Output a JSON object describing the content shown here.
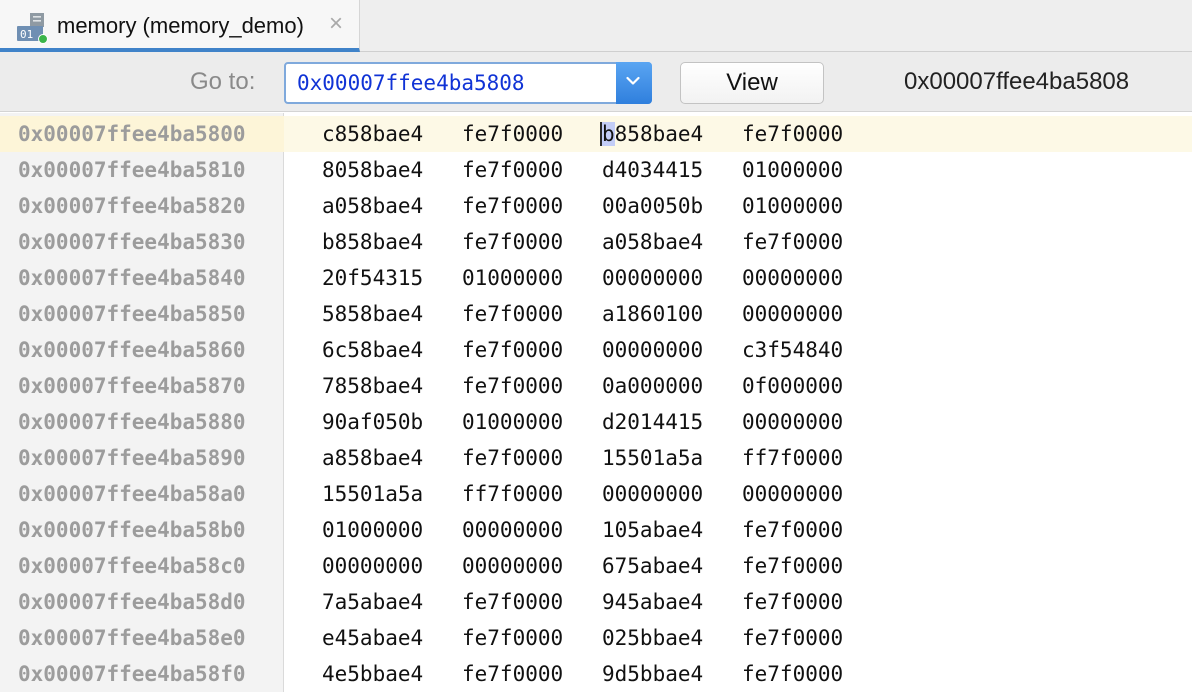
{
  "tab": {
    "title": "memory (memory_demo)",
    "icon_text": "01",
    "close_icon": "×"
  },
  "toolbar": {
    "goto_label": "Go to:",
    "goto_value": "0x00007ffee4ba5808",
    "view_label": "View",
    "current_address": "0x00007ffee4ba5808"
  },
  "colors": {
    "accent": "#4083c9",
    "address_text": "#1033d6",
    "current_row": "#fdf9e6",
    "caret_selection": "#c3cdf7"
  },
  "memory": {
    "current_row_index": 0,
    "caret": {
      "row": 0,
      "word": 2,
      "char": 0
    },
    "rows": [
      {
        "address": "0x00007ffee4ba5800",
        "words": [
          "c858bae4",
          "fe7f0000",
          "b858bae4",
          "fe7f0000"
        ]
      },
      {
        "address": "0x00007ffee4ba5810",
        "words": [
          "8058bae4",
          "fe7f0000",
          "d4034415",
          "01000000"
        ]
      },
      {
        "address": "0x00007ffee4ba5820",
        "words": [
          "a058bae4",
          "fe7f0000",
          "00a0050b",
          "01000000"
        ]
      },
      {
        "address": "0x00007ffee4ba5830",
        "words": [
          "b858bae4",
          "fe7f0000",
          "a058bae4",
          "fe7f0000"
        ]
      },
      {
        "address": "0x00007ffee4ba5840",
        "words": [
          "20f54315",
          "01000000",
          "00000000",
          "00000000"
        ]
      },
      {
        "address": "0x00007ffee4ba5850",
        "words": [
          "5858bae4",
          "fe7f0000",
          "a1860100",
          "00000000"
        ]
      },
      {
        "address": "0x00007ffee4ba5860",
        "words": [
          "6c58bae4",
          "fe7f0000",
          "00000000",
          "c3f54840"
        ]
      },
      {
        "address": "0x00007ffee4ba5870",
        "words": [
          "7858bae4",
          "fe7f0000",
          "0a000000",
          "0f000000"
        ]
      },
      {
        "address": "0x00007ffee4ba5880",
        "words": [
          "90af050b",
          "01000000",
          "d2014415",
          "00000000"
        ]
      },
      {
        "address": "0x00007ffee4ba5890",
        "words": [
          "a858bae4",
          "fe7f0000",
          "15501a5a",
          "ff7f0000"
        ]
      },
      {
        "address": "0x00007ffee4ba58a0",
        "words": [
          "15501a5a",
          "ff7f0000",
          "00000000",
          "00000000"
        ]
      },
      {
        "address": "0x00007ffee4ba58b0",
        "words": [
          "01000000",
          "00000000",
          "105abae4",
          "fe7f0000"
        ]
      },
      {
        "address": "0x00007ffee4ba58c0",
        "words": [
          "00000000",
          "00000000",
          "675abae4",
          "fe7f0000"
        ]
      },
      {
        "address": "0x00007ffee4ba58d0",
        "words": [
          "7a5abae4",
          "fe7f0000",
          "945abae4",
          "fe7f0000"
        ]
      },
      {
        "address": "0x00007ffee4ba58e0",
        "words": [
          "e45abae4",
          "fe7f0000",
          "025bbae4",
          "fe7f0000"
        ]
      },
      {
        "address": "0x00007ffee4ba58f0",
        "words": [
          "4e5bbae4",
          "fe7f0000",
          "9d5bbae4",
          "fe7f0000"
        ]
      }
    ]
  }
}
